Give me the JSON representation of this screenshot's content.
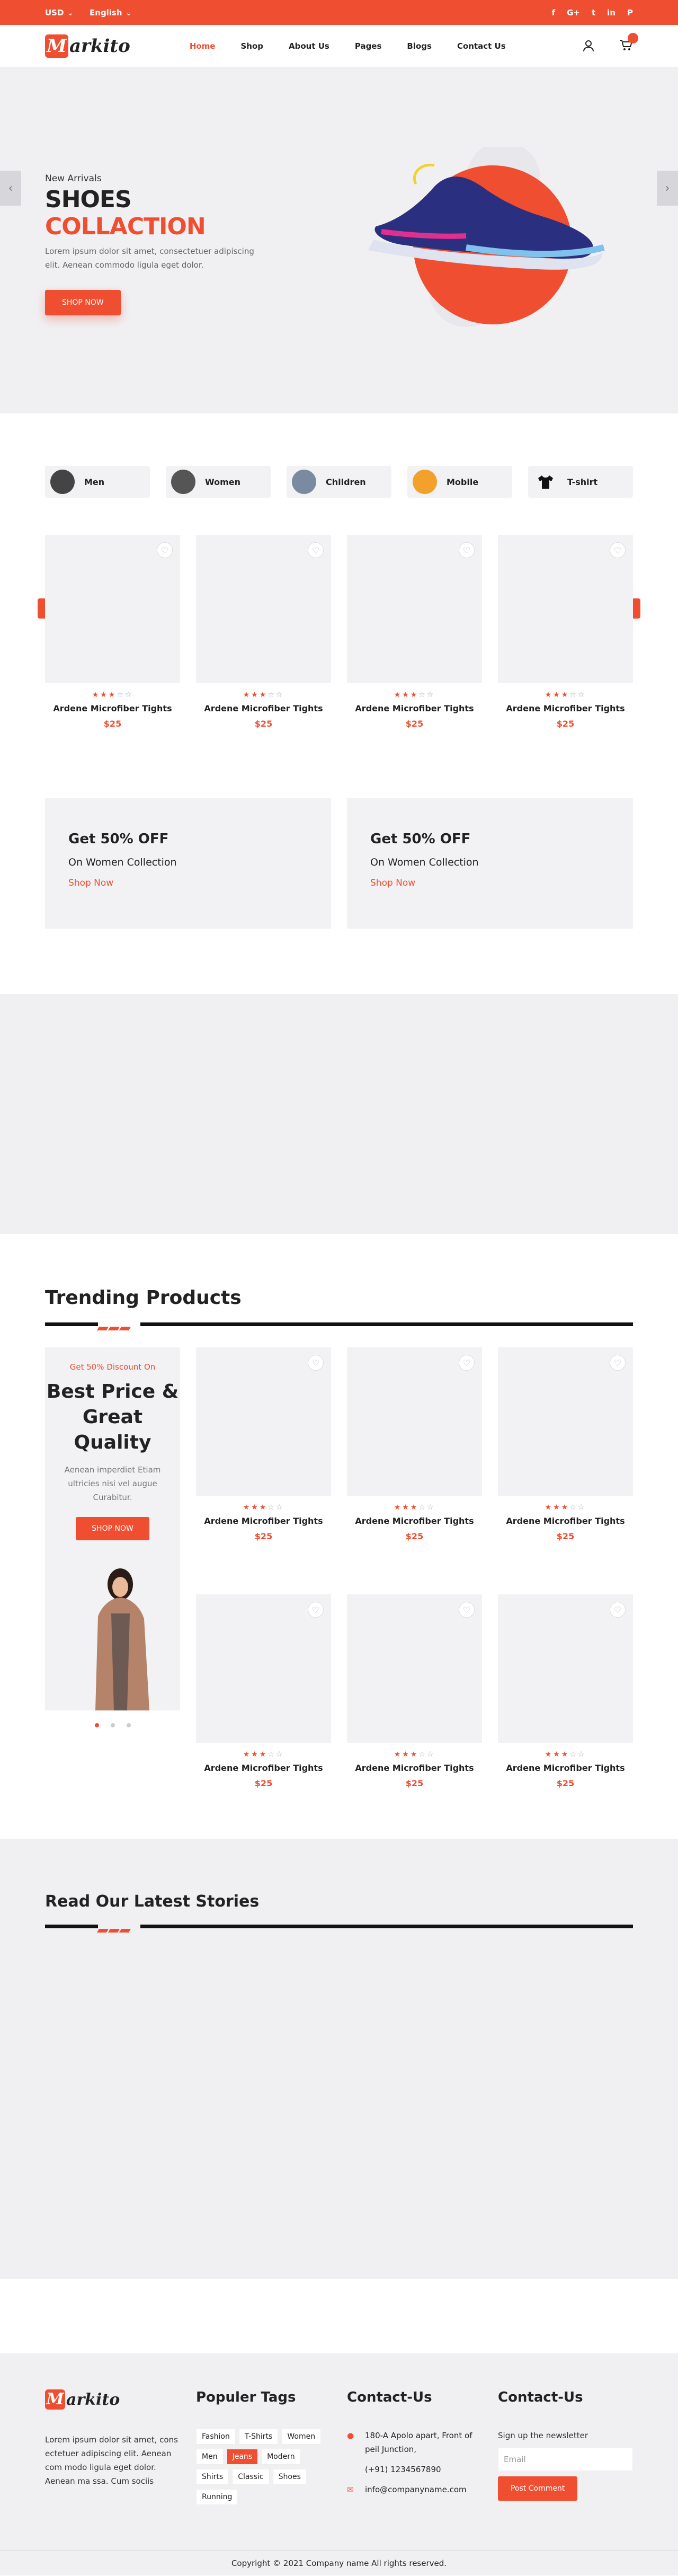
{
  "topbar": {
    "currency": "USD",
    "language": "English",
    "social": [
      "f",
      "G+",
      "t",
      "in",
      "P"
    ]
  },
  "nav": {
    "logo_letter": "M",
    "logo_rest": "arkito",
    "items": [
      "Home",
      "Shop",
      "About Us",
      "Pages",
      "Blogs",
      "Contact Us"
    ]
  },
  "hero": {
    "subtitle": "New Arrivals",
    "title_dark": "SHOES",
    "title_accent": "COLLACTION",
    "desc": "Lorem ipsum dolor sit amet, consectetuer adipiscing elit. Aenean commodo ligula eget dolor.",
    "button": "SHOP NOW"
  },
  "categories": [
    "Men",
    "Women",
    "Children",
    "Mobile",
    "T-shirt"
  ],
  "product": {
    "name": "Ardene Microfiber Tights",
    "price": "$25",
    "rating": 3
  },
  "promos": [
    {
      "title": "Get 50% OFF",
      "sub": "On Women Collection",
      "link": "Shop Now"
    },
    {
      "title": "Get 50% OFF",
      "sub": "On Women Collection",
      "link": "Shop Now"
    }
  ],
  "trending": {
    "title": "Trending Products",
    "discount": "Get 50% Discount On",
    "headline": "Best Price & Great Quality",
    "desc": "Aenean imperdiet Etiam ultricies nisi vel augue Curabitur.",
    "button": "SHOP NOW"
  },
  "stories": {
    "title": "Read Our Latest Stories"
  },
  "footer": {
    "about": "Lorem ipsum dolor sit amet, cons ectetuer adipiscing elit. Aenean com modo ligula eget dolor. Aenean ma ssa. Cum sociis",
    "tags_title": "Populer Tags",
    "tags": [
      "Fashion",
      "T-Shirts",
      "Women",
      "Men",
      "Jeans",
      "Modern",
      "Shirts",
      "Classic",
      "Shoes",
      "Running"
    ],
    "contact_title": "Contact-Us",
    "address": "180-A Apolo apart, Front of peil Junction,",
    "phone": "(+91) 1234567890",
    "email": "info@companyname.com",
    "news_title": "Contact-Us",
    "news_text": "Sign up the newsletter",
    "email_placeholder": "Email",
    "news_button": "Post Comment",
    "copyright": "Copyright © 2021 Company name All rights reserved."
  },
  "colors": {
    "accent": "#f04e31",
    "bg_gray": "#f0f0f3"
  }
}
